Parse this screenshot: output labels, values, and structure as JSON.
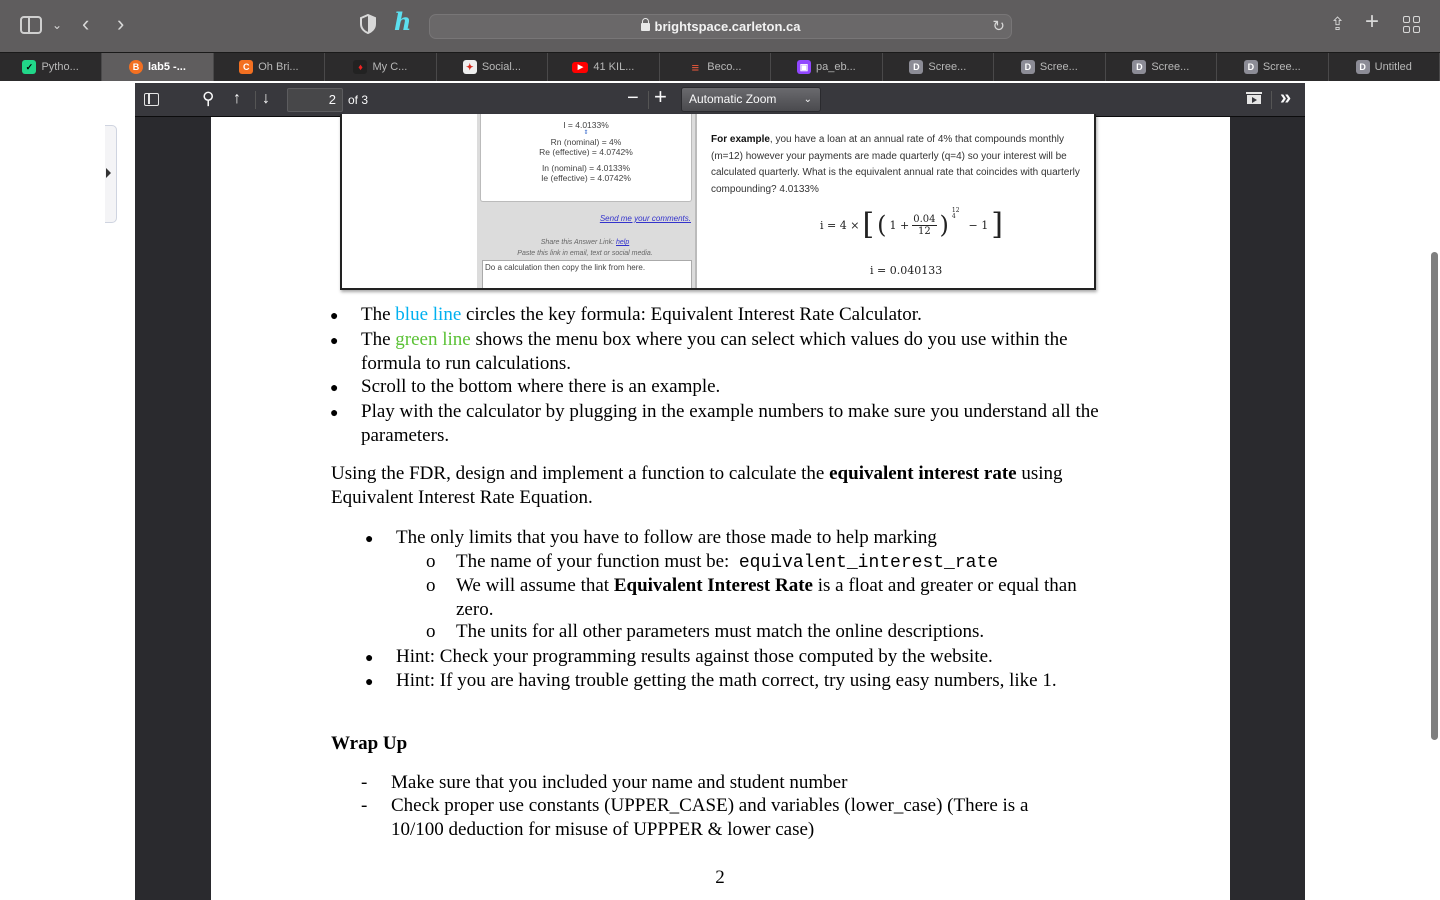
{
  "browser": {
    "url": "brightspace.carleton.ca",
    "tabs": [
      {
        "label": "Pytho...",
        "icon": "pycharm-icon",
        "active": false
      },
      {
        "label": "lab5 -...",
        "icon": "brightspace-icon",
        "active": true
      },
      {
        "label": "Oh Bri...",
        "icon": "c-icon",
        "active": false
      },
      {
        "label": "My C...",
        "icon": "carleton-icon",
        "active": false
      },
      {
        "label": "Social...",
        "icon": "canada-flag-icon",
        "active": false
      },
      {
        "label": "41 KIL...",
        "icon": "youtube-icon",
        "active": false
      },
      {
        "label": "Beco...",
        "icon": "brand-stripes-icon",
        "active": false
      },
      {
        "label": "pa_eb...",
        "icon": "twitch-icon",
        "active": false
      },
      {
        "label": "Scree...",
        "icon": "d-icon",
        "active": false
      },
      {
        "label": "Scree...",
        "icon": "d-icon",
        "active": false
      },
      {
        "label": "Scree...",
        "icon": "d-icon",
        "active": false
      },
      {
        "label": "Scree...",
        "icon": "d-icon",
        "active": false
      },
      {
        "label": "Untitled",
        "icon": "d-icon",
        "active": false
      }
    ]
  },
  "pdf_toolbar": {
    "current_page": "2",
    "page_count_label": "of 3",
    "zoom_label": "Automatic Zoom"
  },
  "embedded_screenshot": {
    "answer_lines": [
      "I = 4.0133%",
      "⇕",
      "Rn (nominal) = 4%",
      "Re (effective) = 4.0742%",
      "",
      "In (nominal) = 4.0133%",
      "Ie (effective) = 4.0742%"
    ],
    "send_comments": "Send me your comments.",
    "share_label": "Share this Answer Link:",
    "share_help": "help",
    "share_hint": "Paste this link in email, text or social media.",
    "link_placeholder": "Do a calculation then copy the link from here.",
    "example_bold": "For example",
    "example_text": ", you have a loan at an annual rate of 4% that compounds monthly (m=12) however your payments are made quarterly (q=4) so your interest will be calculated quarterly.  What is the equivalent annual rate that coincides with quarterly compounding? 4.0133%",
    "formula": {
      "lhs": "i = 4 ×",
      "one_plus": "1 +",
      "numerator": "0.04",
      "denominator": "12",
      "exp_num": "12",
      "exp_den": "4",
      "minus_one": "− 1"
    },
    "result": "i = 0.040133"
  },
  "document": {
    "bullets1": [
      {
        "pre": "The ",
        "colored": "blue line",
        "color": "#00b0f0",
        "post": " circles the key formula:  Equivalent Interest Rate Calculator."
      },
      {
        "pre": "The ",
        "colored": "green line",
        "color": "#5bc236",
        "post": " shows the menu box where you can select which values do you use within the formula to run calculations."
      },
      {
        "text": "Scroll to the bottom where there is an example."
      },
      {
        "text": "Play with the calculator by plugging in the example numbers to make sure you understand all the parameters."
      }
    ],
    "para_pre": "Using the FDR, design and implement a function to calculate the ",
    "para_bold": "equivalent interest rate",
    "para_post": " using Equivalent Interest Rate Equation.",
    "limits_intro": "The only limits that you have to follow are those made to help marking",
    "sub_items": {
      "name_pre": "The name of your function must be:  ",
      "name_code": "equivalent_interest_rate",
      "assume_pre": "We will assume that ",
      "assume_bold": "Equivalent Interest Rate",
      "assume_post": " is a float and greater or equal than zero.",
      "units": "The units for all other parameters must match the online descriptions."
    },
    "hint1": "Hint: Check your programming results against those computed by the website.",
    "hint2": "Hint: If you are having trouble getting the math correct, try using easy numbers, like 1.",
    "wrap_title": "Wrap Up",
    "wrap_items": [
      "Make sure that you included your name and student number",
      "Check proper use constants (UPPER_CASE) and variables (lower_case) (There is a 10/100 deduction for misuse of UPPPER & lower case)"
    ],
    "page_number": "2"
  },
  "colors": {
    "blue_line": "#00b0f0",
    "green_line": "#5bc236"
  }
}
